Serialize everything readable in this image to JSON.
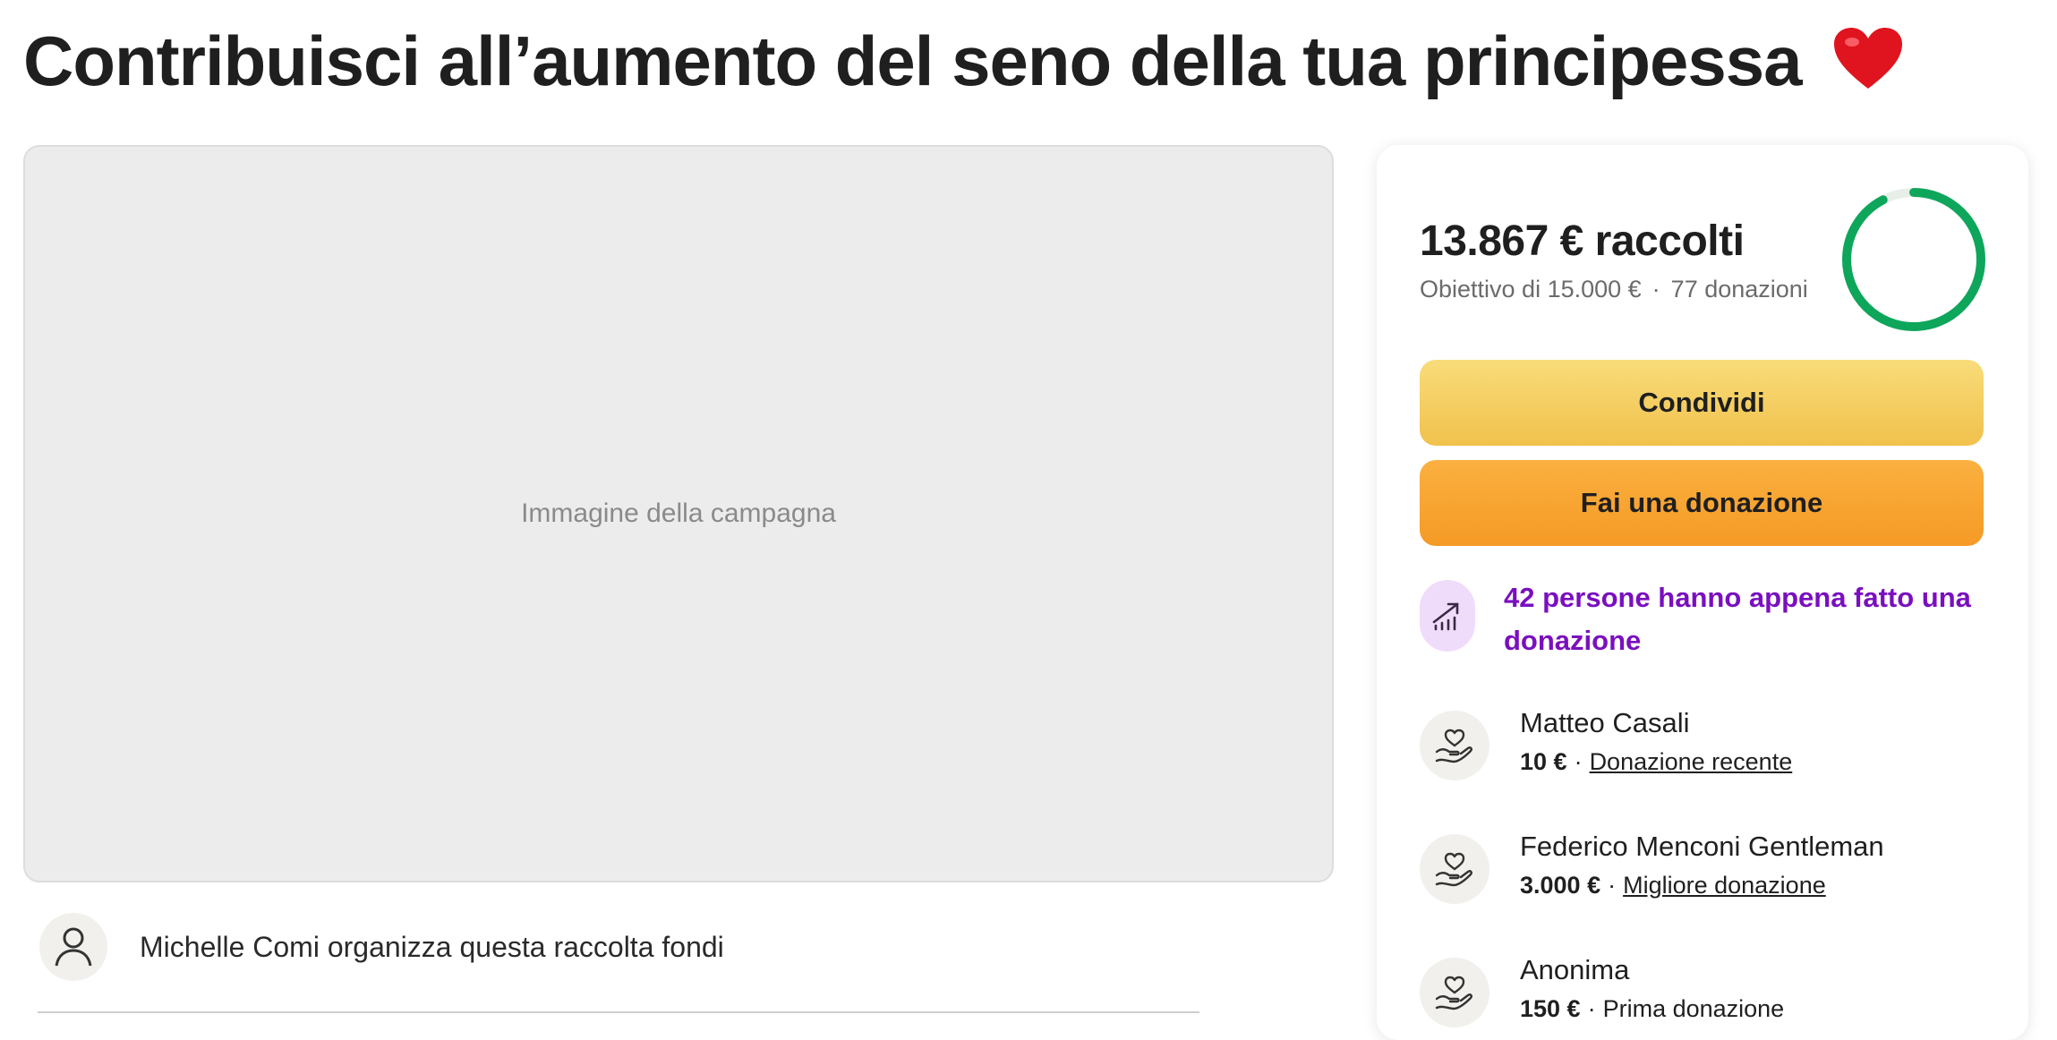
{
  "page": {
    "title": "Contribuisci all’aumento del seno della tua principessa",
    "title_emoji": "heart-emoji"
  },
  "media": {
    "placeholder": "Immagine della campagna"
  },
  "organizer": {
    "text": "Michelle Comi organizza questa raccolta fondi",
    "icon": "person-icon"
  },
  "panel": {
    "raised": "13.867 € raccolti",
    "goal": "Obiettivo di 15.000 €",
    "separator": "·",
    "donation_count": "77 donazioni",
    "progress_fraction": 0.924,
    "progress_color": "#0ea65b",
    "track_color": "#e8efe9",
    "share_label": "Condividi",
    "donate_label": "Fai una donazione",
    "trend_text": "42 persone hanno appena fatto una donazione",
    "trend_color": "#7a0fbf",
    "trend_icon": "trending-up-icon"
  },
  "donors": [
    {
      "name": "Matteo Casali",
      "amount": "10 €",
      "sep": "·",
      "tag": "Donazione recente",
      "icon": "heart-hand-icon"
    },
    {
      "name": "Federico Menconi Gentleman",
      "amount": "3.000 €",
      "sep": "·",
      "tag": "Migliore donazione",
      "icon": "heart-hand-icon"
    },
    {
      "name": "Anonima",
      "amount": "150 €",
      "sep": "·",
      "tag": "Prima donazione",
      "icon": "heart-hand-icon"
    }
  ]
}
